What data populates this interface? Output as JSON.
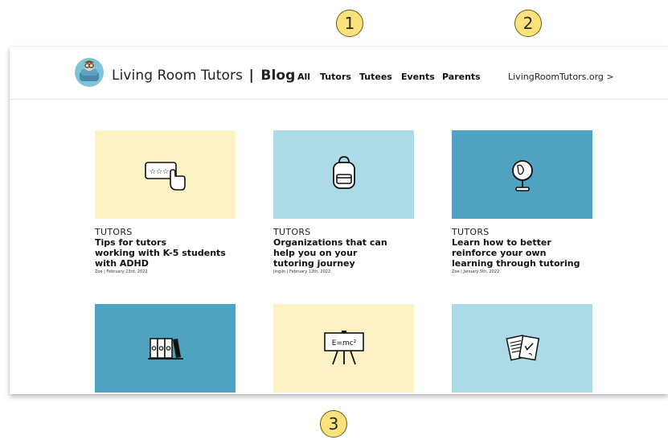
{
  "badges": [
    "1",
    "2",
    "3"
  ],
  "header": {
    "brand": "Living Room Tutors",
    "separator": "|",
    "section": "Blog",
    "nav": [
      "All",
      "Tutors",
      "Tutees",
      "Events",
      "Parents"
    ],
    "external_link": "LivingRoomTutors.org >"
  },
  "posts": [
    {
      "category": "TUTORS",
      "title": "Tips for tutors\nworking with K-5 students\nwith ADHD",
      "meta": "Zoe | February 23rd, 2022",
      "icon": "rating-hand-icon",
      "color": "#fdf1c6"
    },
    {
      "category": "TUTORS",
      "title": "Organizations that can\nhelp you on your\ntutoring journey",
      "meta": "Jinglin | February 12th, 2022",
      "icon": "backpack-icon",
      "color": "#acdae7"
    },
    {
      "category": "TUTORS",
      "title": "Learn how to better\nreinforce your own\nlearning through tutoring",
      "meta": "Zoe | January 5th, 2022",
      "icon": "globe-icon",
      "color": "#4fa2c0"
    },
    {
      "icon": "binders-icon",
      "color": "#4fa2c0"
    },
    {
      "icon": "whiteboard-icon",
      "board_text": "E=mc²",
      "color": "#fdf1c6"
    },
    {
      "icon": "papers-icon",
      "color": "#acdae7"
    }
  ]
}
